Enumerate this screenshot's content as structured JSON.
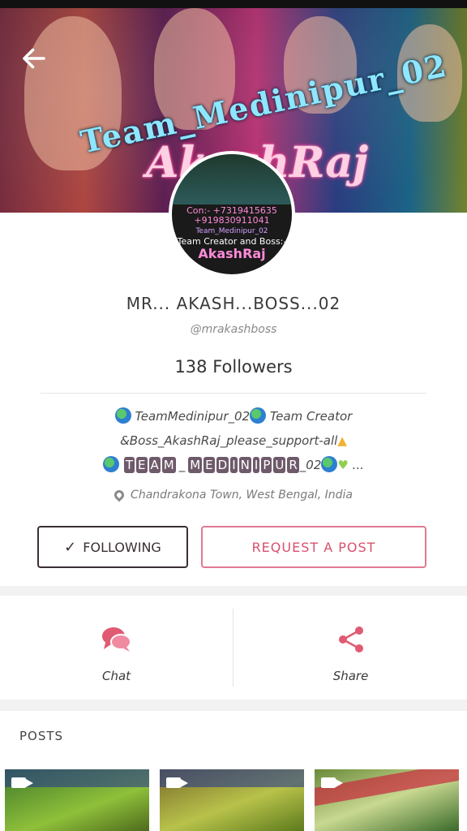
{
  "cover": {
    "arc_text": "Team_Medinipur_02",
    "name_text": "AkashRaj"
  },
  "avatar": {
    "line1": "Con:- +7319415635",
    "line2": "+919830911041",
    "line3": "Team_Medinipur_02",
    "line4": "Team Creator and Boss:-",
    "line5": "AkashRaj"
  },
  "profile": {
    "name": "MR... AKASH...BOSS...02",
    "handle": "@mrakashboss",
    "followers": "138 Followers",
    "bio": {
      "line1_a": "TeamMedinipur_02",
      "line1_b": "Team Creator",
      "line2": "&Boss_AkashRaj_please_support-all",
      "line3_letters": [
        "T",
        "E",
        "A",
        "M",
        "_",
        "M",
        "E",
        "D",
        "I",
        "N",
        "I",
        "P",
        "U",
        "R"
      ],
      "line3_suffix": "_02",
      "more": "..."
    },
    "location": "Chandrakona Town, West Bengal, India"
  },
  "buttons": {
    "following": "FOLLOWING",
    "request": "REQUEST A POST"
  },
  "actions": {
    "chat": "Chat",
    "share": "Share"
  },
  "posts": {
    "title": "POSTS"
  },
  "colors": {
    "accent": "#d8506e",
    "dark_border": "#3b2e35"
  }
}
